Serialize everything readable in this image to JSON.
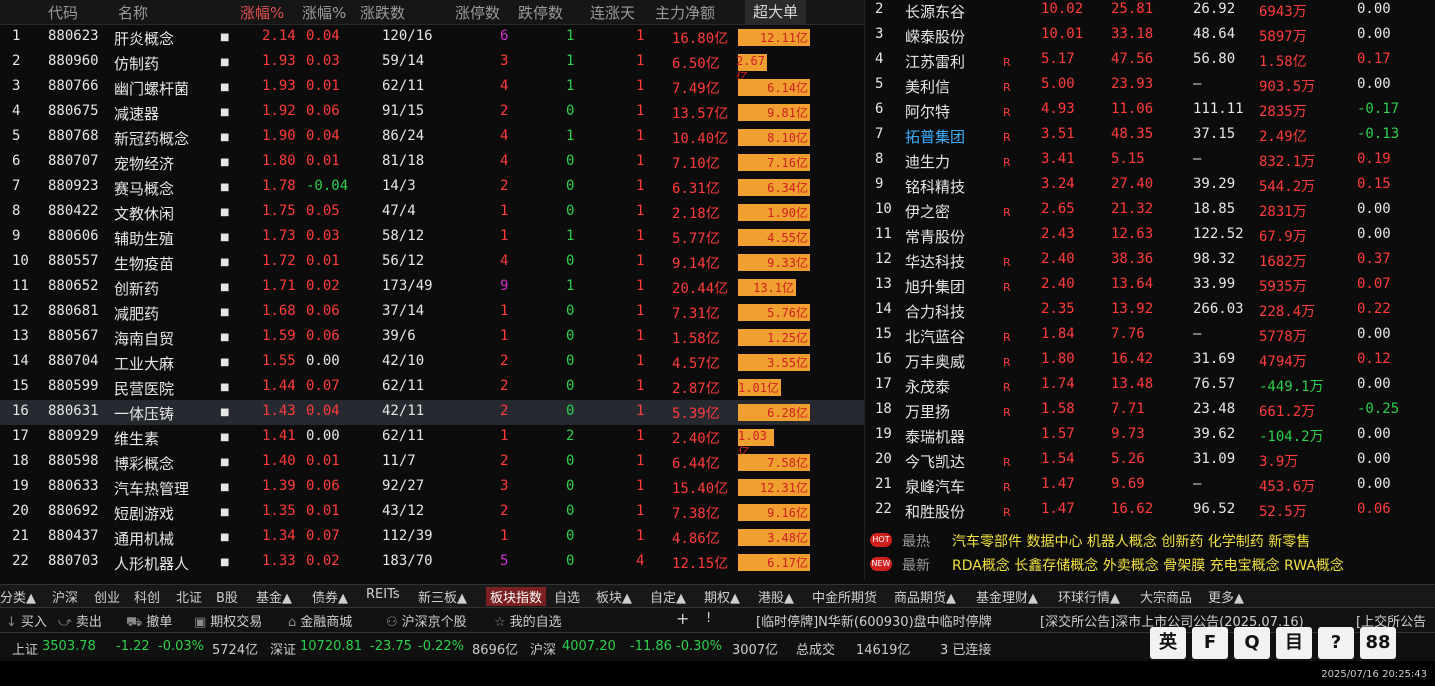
{
  "left_header": {
    "col_code": "代码",
    "col_name": "名称",
    "col_change": "涨幅%",
    "col_speed": "涨幅%",
    "col_updown": "涨跌数",
    "col_limitup": "涨停数",
    "col_limitdown": "跌停数",
    "col_streak": "连涨天",
    "col_mainflow": "主力净额",
    "col_big": "超大单"
  },
  "left_rows": [
    {
      "idx": "1",
      "code": "880623",
      "name": "肝炎概念",
      "chg": "2.14",
      "spd": "0.04",
      "ud": "120/16",
      "up": "6",
      "dn": "1",
      "days": "1",
      "flow": "16.80亿",
      "big": "12.11亿",
      "bar": 1.0
    },
    {
      "idx": "2",
      "code": "880960",
      "name": "仿制药",
      "chg": "1.93",
      "spd": "0.03",
      "ud": "59/14",
      "up": "3",
      "dn": "1",
      "days": "1",
      "flow": "6.50亿",
      "big": "2.67亿",
      "bar": 0.4
    },
    {
      "idx": "3",
      "code": "880766",
      "name": "幽门螺杆菌",
      "chg": "1.93",
      "spd": "0.01",
      "ud": "62/11",
      "up": "4",
      "dn": "1",
      "days": "1",
      "flow": "7.49亿",
      "big": "6.14亿",
      "bar": 1.0
    },
    {
      "idx": "4",
      "code": "880675",
      "name": "减速器",
      "chg": "1.92",
      "spd": "0.06",
      "ud": "91/15",
      "up": "2",
      "dn": "0",
      "days": "1",
      "flow": "13.57亿",
      "big": "9.81亿",
      "bar": 1.0
    },
    {
      "idx": "5",
      "code": "880768",
      "name": "新冠药概念",
      "chg": "1.90",
      "spd": "0.04",
      "ud": "86/24",
      "up": "4",
      "dn": "1",
      "days": "1",
      "flow": "10.40亿",
      "big": "8.10亿",
      "bar": 1.0
    },
    {
      "idx": "6",
      "code": "880707",
      "name": "宠物经济",
      "chg": "1.80",
      "spd": "0.01",
      "ud": "81/18",
      "up": "4",
      "dn": "0",
      "days": "1",
      "flow": "7.10亿",
      "big": "7.16亿",
      "bar": 1.0
    },
    {
      "idx": "7",
      "code": "880923",
      "name": "赛马概念",
      "chg": "1.78",
      "spd": "-0.04",
      "ud": "14/3",
      "up": "2",
      "dn": "0",
      "days": "1",
      "flow": "6.31亿",
      "big": "6.34亿",
      "bar": 1.0
    },
    {
      "idx": "8",
      "code": "880422",
      "name": "文教休闲",
      "chg": "1.75",
      "spd": "0.05",
      "ud": "47/4",
      "up": "1",
      "dn": "0",
      "days": "1",
      "flow": "2.18亿",
      "big": "1.90亿",
      "bar": 1.0
    },
    {
      "idx": "9",
      "code": "880606",
      "name": "辅助生殖",
      "chg": "1.73",
      "spd": "0.03",
      "ud": "58/12",
      "up": "1",
      "dn": "1",
      "days": "1",
      "flow": "5.77亿",
      "big": "4.55亿",
      "bar": 1.0
    },
    {
      "idx": "10",
      "code": "880557",
      "name": "生物疫苗",
      "chg": "1.72",
      "spd": "0.01",
      "ud": "56/12",
      "up": "4",
      "dn": "0",
      "days": "1",
      "flow": "9.14亿",
      "big": "9.33亿",
      "bar": 1.0
    },
    {
      "idx": "11",
      "code": "880652",
      "name": "创新药",
      "chg": "1.71",
      "spd": "0.02",
      "ud": "173/49",
      "up": "9",
      "dn": "1",
      "days": "1",
      "flow": "20.44亿",
      "big": "13.1亿",
      "bar": 0.8
    },
    {
      "idx": "12",
      "code": "880681",
      "name": "减肥药",
      "chg": "1.68",
      "spd": "0.06",
      "ud": "37/14",
      "up": "1",
      "dn": "0",
      "days": "1",
      "flow": "7.31亿",
      "big": "5.76亿",
      "bar": 1.0
    },
    {
      "idx": "13",
      "code": "880567",
      "name": "海南自贸",
      "chg": "1.59",
      "spd": "0.06",
      "ud": "39/6",
      "up": "1",
      "dn": "0",
      "days": "1",
      "flow": "1.58亿",
      "big": "1.25亿",
      "bar": 1.0
    },
    {
      "idx": "14",
      "code": "880704",
      "name": "工业大麻",
      "chg": "1.55",
      "spd": "0.00",
      "ud": "42/10",
      "up": "2",
      "dn": "0",
      "days": "1",
      "flow": "4.57亿",
      "big": "3.55亿",
      "bar": 1.0
    },
    {
      "idx": "15",
      "code": "880599",
      "name": "民营医院",
      "chg": "1.44",
      "spd": "0.07",
      "ud": "62/11",
      "up": "2",
      "dn": "0",
      "days": "1",
      "flow": "2.87亿",
      "big": "1.01亿",
      "bar": 0.6
    },
    {
      "idx": "16",
      "code": "880631",
      "name": "一体压铸",
      "chg": "1.43",
      "spd": "0.04",
      "ud": "42/11",
      "up": "2",
      "dn": "0",
      "days": "1",
      "flow": "5.39亿",
      "big": "6.28亿",
      "bar": 1.0
    },
    {
      "idx": "17",
      "code": "880929",
      "name": "维生素",
      "chg": "1.41",
      "spd": "0.00",
      "ud": "62/11",
      "up": "1",
      "dn": "2",
      "days": "1",
      "flow": "2.40亿",
      "big": "1.03亿",
      "bar": 0.5
    },
    {
      "idx": "18",
      "code": "880598",
      "name": "博彩概念",
      "chg": "1.40",
      "spd": "0.01",
      "ud": "11/7",
      "up": "2",
      "dn": "0",
      "days": "1",
      "flow": "6.44亿",
      "big": "7.58亿",
      "bar": 1.0
    },
    {
      "idx": "19",
      "code": "880633",
      "name": "汽车热管理",
      "chg": "1.39",
      "spd": "0.06",
      "ud": "92/27",
      "up": "3",
      "dn": "0",
      "days": "1",
      "flow": "15.40亿",
      "big": "12.31亿",
      "bar": 1.0
    },
    {
      "idx": "20",
      "code": "880692",
      "name": "短剧游戏",
      "chg": "1.35",
      "spd": "0.01",
      "ud": "43/12",
      "up": "2",
      "dn": "0",
      "days": "1",
      "flow": "7.38亿",
      "big": "9.16亿",
      "bar": 1.0
    },
    {
      "idx": "21",
      "code": "880437",
      "name": "通用机械",
      "chg": "1.34",
      "spd": "0.07",
      "ud": "112/39",
      "up": "1",
      "dn": "0",
      "days": "1",
      "flow": "4.86亿",
      "big": "3.48亿",
      "bar": 1.0
    },
    {
      "idx": "22",
      "code": "880703",
      "name": "人形机器人",
      "chg": "1.33",
      "spd": "0.02",
      "ud": "183/70",
      "up": "5",
      "dn": "0",
      "days": "4",
      "flow": "12.15亿",
      "big": "6.17亿",
      "bar": 1.0
    }
  ],
  "right_rows": [
    {
      "idx": "2",
      "name": "长源东谷",
      "r": "",
      "chg": "10.02",
      "turn": "25.81",
      "pe": "26.92",
      "flow": "6943万",
      "spd": "0.00"
    },
    {
      "idx": "3",
      "name": "嵘泰股份",
      "r": "",
      "chg": "10.01",
      "turn": "33.18",
      "pe": "48.64",
      "flow": "5897万",
      "spd": "0.00"
    },
    {
      "idx": "4",
      "name": "江苏雷利",
      "r": "R",
      "chg": "5.17",
      "turn": "47.56",
      "pe": "56.80",
      "flow": "1.58亿",
      "spd": "0.17"
    },
    {
      "idx": "5",
      "name": "美利信",
      "r": "R",
      "chg": "5.00",
      "turn": "23.93",
      "pe": "–",
      "flow": "903.5万",
      "spd": "0.00"
    },
    {
      "idx": "6",
      "name": "阿尔特",
      "r": "R",
      "chg": "4.93",
      "turn": "11.06",
      "pe": "111.11",
      "flow": "2835万",
      "spd": "-0.17"
    },
    {
      "idx": "7",
      "name": "拓普集团",
      "r": "R",
      "chg": "3.51",
      "turn": "48.35",
      "pe": "37.15",
      "flow": "2.49亿",
      "spd": "-0.13"
    },
    {
      "idx": "8",
      "name": "迪生力",
      "r": "R",
      "chg": "3.41",
      "turn": "5.15",
      "pe": "–",
      "flow": "832.1万",
      "spd": "0.19"
    },
    {
      "idx": "9",
      "name": "铭科精技",
      "r": "",
      "chg": "3.24",
      "turn": "27.40",
      "pe": "39.29",
      "flow": "544.2万",
      "spd": "0.15"
    },
    {
      "idx": "10",
      "name": "伊之密",
      "r": "R",
      "chg": "2.65",
      "turn": "21.32",
      "pe": "18.85",
      "flow": "2831万",
      "spd": "0.00"
    },
    {
      "idx": "11",
      "name": "常青股份",
      "r": "",
      "chg": "2.43",
      "turn": "12.63",
      "pe": "122.52",
      "flow": "67.9万",
      "spd": "0.00"
    },
    {
      "idx": "12",
      "name": "华达科技",
      "r": "R",
      "chg": "2.40",
      "turn": "38.36",
      "pe": "98.32",
      "flow": "1682万",
      "spd": "0.37"
    },
    {
      "idx": "13",
      "name": "旭升集团",
      "r": "R",
      "chg": "2.40",
      "turn": "13.64",
      "pe": "33.99",
      "flow": "5935万",
      "spd": "0.07"
    },
    {
      "idx": "14",
      "name": "合力科技",
      "r": "",
      "chg": "2.35",
      "turn": "13.92",
      "pe": "266.03",
      "flow": "228.4万",
      "spd": "0.22"
    },
    {
      "idx": "15",
      "name": "北汽蓝谷",
      "r": "R",
      "chg": "1.84",
      "turn": "7.76",
      "pe": "–",
      "flow": "5778万",
      "spd": "0.00"
    },
    {
      "idx": "16",
      "name": "万丰奥威",
      "r": "R",
      "chg": "1.80",
      "turn": "16.42",
      "pe": "31.69",
      "flow": "4794万",
      "spd": "0.12"
    },
    {
      "idx": "17",
      "name": "永茂泰",
      "r": "R",
      "chg": "1.74",
      "turn": "13.48",
      "pe": "76.57",
      "flow": "-449.1万",
      "spd": "0.00"
    },
    {
      "idx": "18",
      "name": "万里扬",
      "r": "R",
      "chg": "1.58",
      "turn": "7.71",
      "pe": "23.48",
      "flow": "661.2万",
      "spd": "-0.25"
    },
    {
      "idx": "19",
      "name": "泰瑞机器",
      "r": "",
      "chg": "1.57",
      "turn": "9.73",
      "pe": "39.62",
      "flow": "-104.2万",
      "spd": "0.00"
    },
    {
      "idx": "20",
      "name": "今飞凯达",
      "r": "R",
      "chg": "1.54",
      "turn": "5.26",
      "pe": "31.09",
      "flow": "3.9万",
      "spd": "0.00"
    },
    {
      "idx": "21",
      "name": "泉峰汽车",
      "r": "R",
      "chg": "1.47",
      "turn": "9.69",
      "pe": "–",
      "flow": "453.6万",
      "spd": "0.00"
    },
    {
      "idx": "22",
      "name": "和胜股份",
      "r": "R",
      "chg": "1.47",
      "turn": "16.62",
      "pe": "96.52",
      "flow": "52.5万",
      "spd": "0.06"
    }
  ],
  "hot": {
    "hot_badge": "HOT",
    "hot_label": "最热",
    "hot_items": "汽车零部件  数据中心  机器人概念  创新药  化学制药  新零售",
    "new_badge": "NEW",
    "new_label": "最新",
    "new_items": "RDA概念  长鑫存储概念  外卖概念  骨架膜  充电宝概念  RWA概念"
  },
  "tabs": [
    "分类▲",
    "沪深",
    "创业",
    "科创",
    "北证",
    "B股",
    "基金▲",
    "债券▲",
    "REITs",
    "新三板▲",
    "板块指数",
    "自选",
    "板块▲",
    "自定▲",
    "期权▲",
    "港股▲",
    "中金所期货",
    "商品期货▲",
    "基金理财▲",
    "环球行情▲",
    "大宗商品",
    "更多▲"
  ],
  "tools": [
    "买入",
    "卖出",
    "撤单",
    "期权交易",
    "金融商城",
    "沪深京个股",
    "我的自选",
    "+",
    "!"
  ],
  "ticker": "[临时停牌]N华新(600930)盘中临时停牌",
  "notice1": "[深交所公告]深市上市公司公告(2025.07.16)",
  "notice2": "[上交所公告",
  "status": {
    "sh_label": "上证",
    "sh_val": "3503.78",
    "sh_chg": "-1.22",
    "sh_pct": "-0.03%",
    "sh_amt": "5724亿",
    "sz_label": "深证",
    "sz_val": "10720.81",
    "sz_chg": "-23.75",
    "sz_pct": "-0.22%",
    "sz_amt": "8696亿",
    "hs_label": "沪深",
    "hs_val": "4007.20",
    "hs_chg": "-11.86",
    "hs_pct": "-0.30%",
    "hs_amt": "3007亿",
    "total_label": "总成交",
    "total_amt": "14619亿",
    "conn": "3 已连接"
  },
  "timestamp": "2025/07/16 20:25:43",
  "float_icons": [
    "英",
    "F",
    "Q",
    "目",
    "?",
    "88"
  ],
  "colors": {
    "up": "#ff3b3b",
    "down": "#2cd04a",
    "bar": "#f0a030",
    "hot": "#f0e040"
  }
}
